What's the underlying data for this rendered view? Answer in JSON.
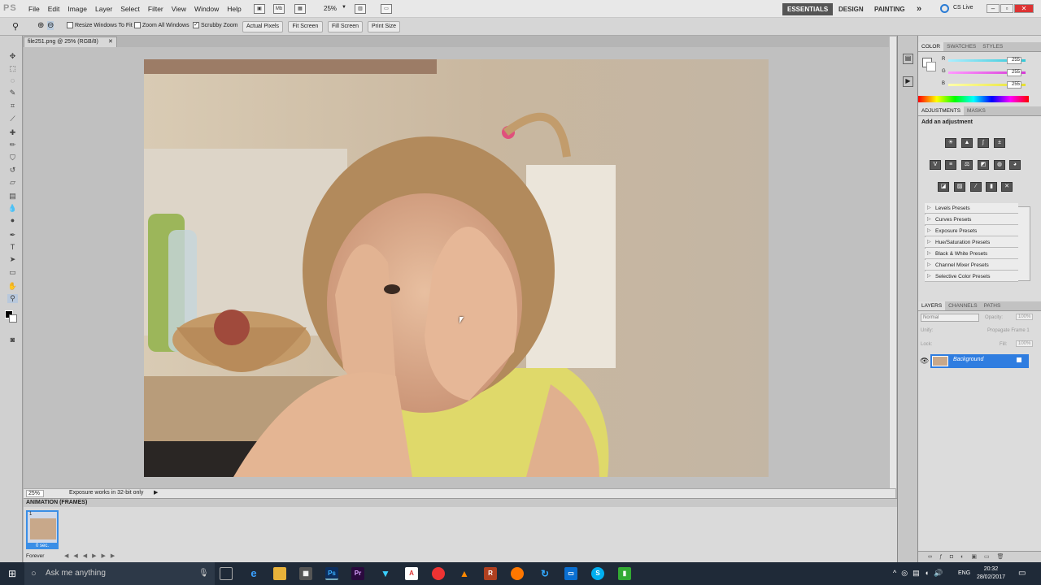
{
  "menubar": {
    "logo": "PS",
    "items": [
      "File",
      "Edit",
      "Image",
      "Layer",
      "Select",
      "Filter",
      "View",
      "Window",
      "Help"
    ],
    "zoom": "25%",
    "workspaces": [
      "ESSENTIALS",
      "DESIGN",
      "PAINTING"
    ],
    "overflow": "»",
    "cslive": "CS Live"
  },
  "optionsbar": {
    "resize_windows": "Resize Windows To Fit",
    "zoom_all": "Zoom All Windows",
    "scrubby": "Scrubby Zoom",
    "actual_pixels": "Actual Pixels",
    "fit_screen": "Fit Screen",
    "fill_screen": "Fill Screen",
    "print_size": "Print Size"
  },
  "document": {
    "tab": "file251.png @ 25% (RGB/8)",
    "status_zoom": "25%",
    "status_text": "Exposure works in 32-bit only"
  },
  "animation": {
    "title": "ANIMATION (FRAMES)",
    "frame_number": "1",
    "frame_delay": "0 sec.",
    "loop": "Forever"
  },
  "color_panel": {
    "tabs": [
      "COLOR",
      "SWATCHES",
      "STYLES"
    ],
    "channels": [
      {
        "label": "R",
        "value": "255",
        "color": "#33c7d6"
      },
      {
        "label": "G",
        "value": "255",
        "color": "#d63ad6"
      },
      {
        "label": "B",
        "value": "255",
        "color": "#e6e02e"
      }
    ]
  },
  "adjustments_panel": {
    "tabs": [
      "ADJUSTMENTS",
      "MASKS"
    ],
    "title": "Add an adjustment",
    "presets": [
      "Levels Presets",
      "Curves Presets",
      "Exposure Presets",
      "Hue/Saturation Presets",
      "Black & White Presets",
      "Channel Mixer Presets",
      "Selective Color Presets"
    ]
  },
  "layers_panel": {
    "tabs": [
      "LAYERS",
      "CHANNELS",
      "PATHS"
    ],
    "blend_mode": "Normal",
    "opacity_label": "Opacity:",
    "opacity": "100%",
    "unify_label": "Unify:",
    "propagate": "Propagate Frame 1",
    "lock_label": "Lock:",
    "fill_label": "Fill:",
    "fill": "100%",
    "layer_name": "Background"
  },
  "taskbar": {
    "search_placeholder": "Ask me anything",
    "lang": "ENG",
    "time": "20:32",
    "date": "28/02/2017"
  }
}
